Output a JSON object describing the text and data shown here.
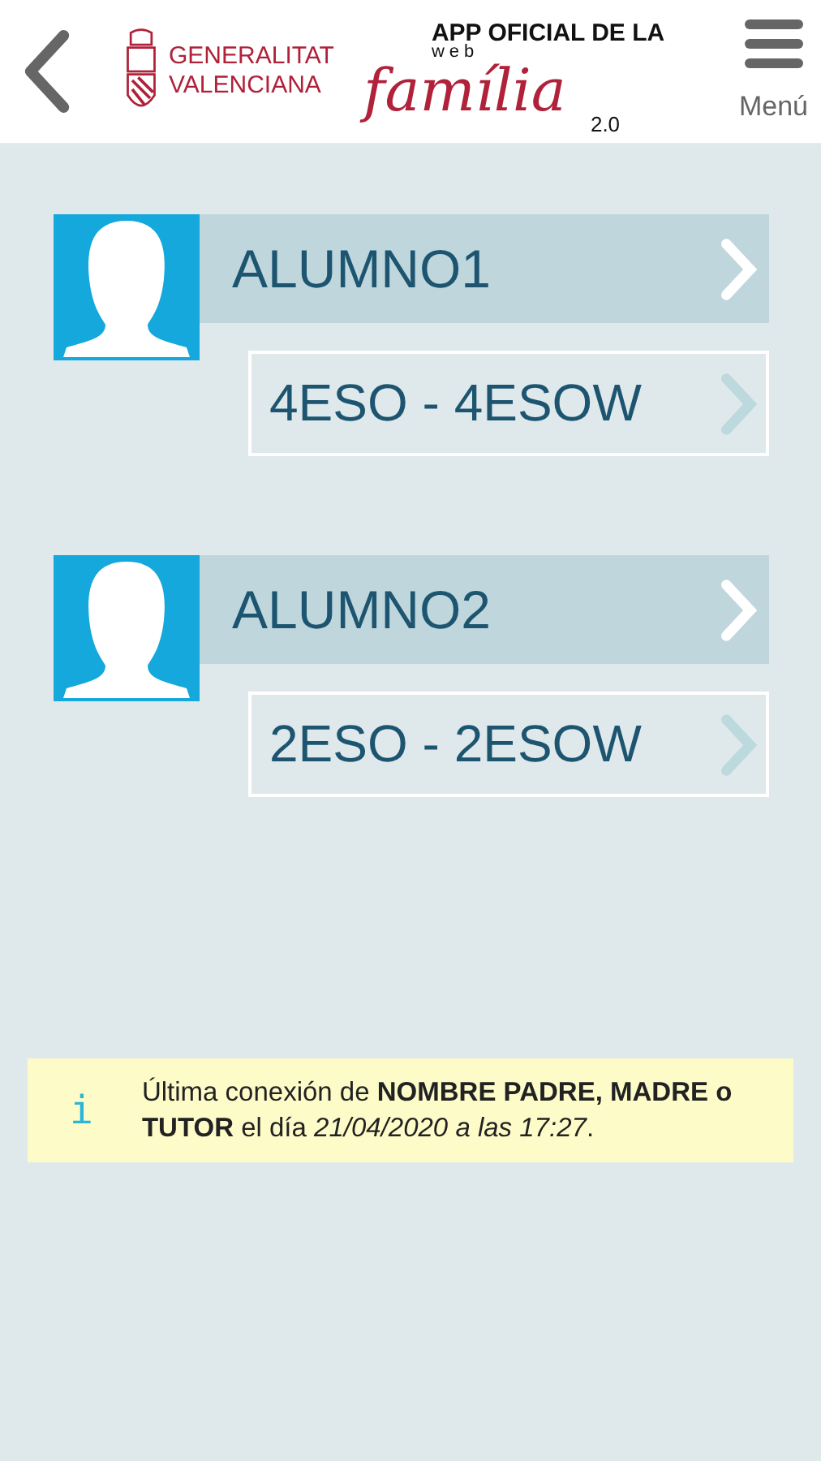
{
  "header": {
    "org_line1": "GENERALITAT",
    "org_line2": "VALENCIANA",
    "app_title": "APP OFICIAL DE LA",
    "app_web": "web",
    "app_name": "família",
    "app_version": "2.0",
    "menu_label": "Menú"
  },
  "students": [
    {
      "name": "ALUMNO1",
      "group": "4ESO - 4ESOW"
    },
    {
      "name": "ALUMNO2",
      "group": "2ESO - 2ESOW"
    }
  ],
  "info": {
    "icon": "i",
    "text": "Última conexión de **NOMBRE PADRE, MADRE o TUTOR** el día *21/04/2020 a las 17:27*."
  }
}
